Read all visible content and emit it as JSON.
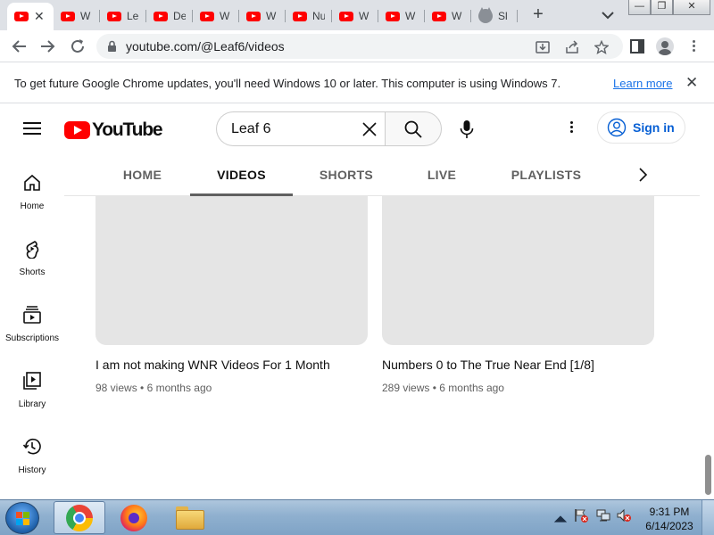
{
  "browser": {
    "tabs": [
      {
        "title": "",
        "favicon": "youtube-icon",
        "active": true
      },
      {
        "title": "W",
        "favicon": "youtube-icon"
      },
      {
        "title": "Le",
        "favicon": "youtube-icon"
      },
      {
        "title": "De",
        "favicon": "youtube-icon"
      },
      {
        "title": "W",
        "favicon": "youtube-icon"
      },
      {
        "title": "W",
        "favicon": "youtube-icon"
      },
      {
        "title": "Nu",
        "favicon": "youtube-icon"
      },
      {
        "title": "W",
        "favicon": "youtube-icon"
      },
      {
        "title": "W",
        "favicon": "youtube-icon"
      },
      {
        "title": "W",
        "favicon": "youtube-icon"
      },
      {
        "title": "Sl",
        "favicon": "cat-icon"
      }
    ],
    "new_tab": "+",
    "address": {
      "url": "youtube.com/@Leaf6/videos"
    },
    "infobar": {
      "message": "To get future Google Chrome updates, you'll need Windows 10 or later. This computer is using Windows 7.",
      "link": "Learn more",
      "close": "✕"
    }
  },
  "youtube": {
    "logo_text": "YouTube",
    "search_query": "Leaf 6",
    "sign_in": "Sign in",
    "guide": [
      {
        "label": "Home",
        "icon": "home-icon"
      },
      {
        "label": "Shorts",
        "icon": "shorts-icon"
      },
      {
        "label": "Subscriptions",
        "icon": "subscriptions-icon"
      },
      {
        "label": "Library",
        "icon": "library-icon"
      },
      {
        "label": "History",
        "icon": "history-icon"
      }
    ],
    "channel_tabs": [
      {
        "label": "HOME"
      },
      {
        "label": "VIDEOS",
        "active": true
      },
      {
        "label": "SHORTS"
      },
      {
        "label": "LIVE"
      },
      {
        "label": "PLAYLISTS"
      }
    ],
    "videos": [
      {
        "title": "I am not making WNR Videos For 1 Month",
        "views": "98 views",
        "sep": "•",
        "age": "6 months ago"
      },
      {
        "title": "Numbers 0 to The True Near End [1/8]",
        "views": "289 views",
        "sep": "•",
        "age": "6 months ago"
      }
    ]
  },
  "taskbar": {
    "apps": [
      "chrome-icon",
      "firefox-icon",
      "explorer-icon"
    ],
    "time": "9:31 PM",
    "date": "6/14/2023"
  },
  "colors": {
    "youtube_red": "#ff0000",
    "link_blue": "#065fd4",
    "chrome_link": "#1a73e8"
  }
}
